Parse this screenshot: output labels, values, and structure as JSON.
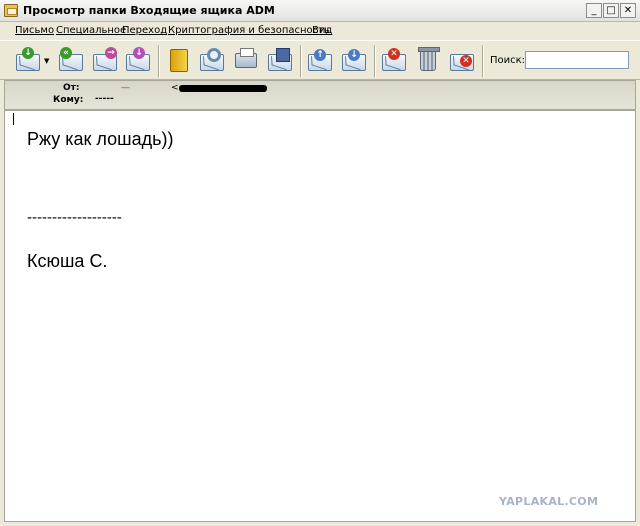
{
  "window": {
    "title": "Просмотр папки Входящие ящика ADM",
    "buttons": {
      "minimize": "_",
      "maximize": "□",
      "close": "✕"
    }
  },
  "menu": [
    {
      "id": "letter",
      "label": "Письмо"
    },
    {
      "id": "special",
      "label": "Специальное"
    },
    {
      "id": "goto",
      "label": "Переход"
    },
    {
      "id": "crypto",
      "label": "Криптография и безопасность"
    },
    {
      "id": "view",
      "label": "Вид"
    }
  ],
  "toolbar": {
    "icons": [
      "receive-mail-icon",
      "dropdown-arrow-icon",
      "reply-all-icon",
      "forward-icon",
      "redirect-icon",
      "address-book-icon",
      "search-mail-icon",
      "print-icon",
      "save-icon",
      "move-up-icon",
      "move-down-icon",
      "delete-mark-icon",
      "trash-icon",
      "delete-icon"
    ],
    "search_label": "Поиск:",
    "search_value": ""
  },
  "header": {
    "from_label": "От:",
    "from_value": "<",
    "to_label": "Кому:",
    "to_value": "-----"
  },
  "message": {
    "lines": [
      "Ржу как лошадь))",
      "-------------------",
      "Ксюша С."
    ]
  },
  "watermark": "YAPLAKAL.COM",
  "colors": {
    "window_bg": "#ece9d8",
    "body_bg": "#ffffff",
    "watermark": "#a7b3c6"
  }
}
